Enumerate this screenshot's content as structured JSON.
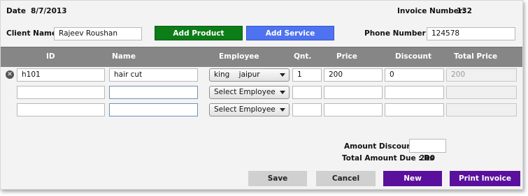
{
  "header": {
    "date_label": "Date",
    "date_value": "8/7/2013",
    "invoice_label": "Invoice Number:",
    "invoice_value": "132"
  },
  "client": {
    "label": "Client Name",
    "value": "Rajeev Roushan"
  },
  "buttons": {
    "add_product": "Add Product",
    "add_service": "Add Service"
  },
  "phone": {
    "label": "Phone Number",
    "value": "124578"
  },
  "table": {
    "columns": [
      "ID",
      "Name",
      "Employee",
      "Qnt.",
      "Price",
      "Discount",
      "Total Price"
    ],
    "rows": [
      {
        "id": "h101",
        "name": "hair cut",
        "employee": "king    jaipur",
        "qnt": "1",
        "price": "200",
        "discount": "0",
        "total": "200"
      },
      {
        "id": "",
        "name": "",
        "employee": "Select Employee",
        "qnt": "",
        "price": "",
        "discount": "",
        "total": ""
      },
      {
        "id": "",
        "name": "",
        "employee": "Select Employee",
        "qnt": "",
        "price": "",
        "discount": "",
        "total": ""
      }
    ]
  },
  "summary": {
    "amount_discount_label": "Amount Discount :",
    "amount_discount_value": "",
    "total_due_label": "Total Amount Due : Rs",
    "total_due_value": "200"
  },
  "footer": {
    "save": "Save",
    "cancel": "Cancel",
    "new": "New",
    "print": "Print Invoice"
  },
  "colors": {
    "add_product": "#0d7d17",
    "add_service": "#4f73f0",
    "header_bar": "#868686",
    "purple": "#5a109c",
    "gray_button": "#d0d0d0"
  },
  "icons": {
    "delete_row": "circle-x-icon",
    "dropdown": "chevron-down-icon"
  }
}
